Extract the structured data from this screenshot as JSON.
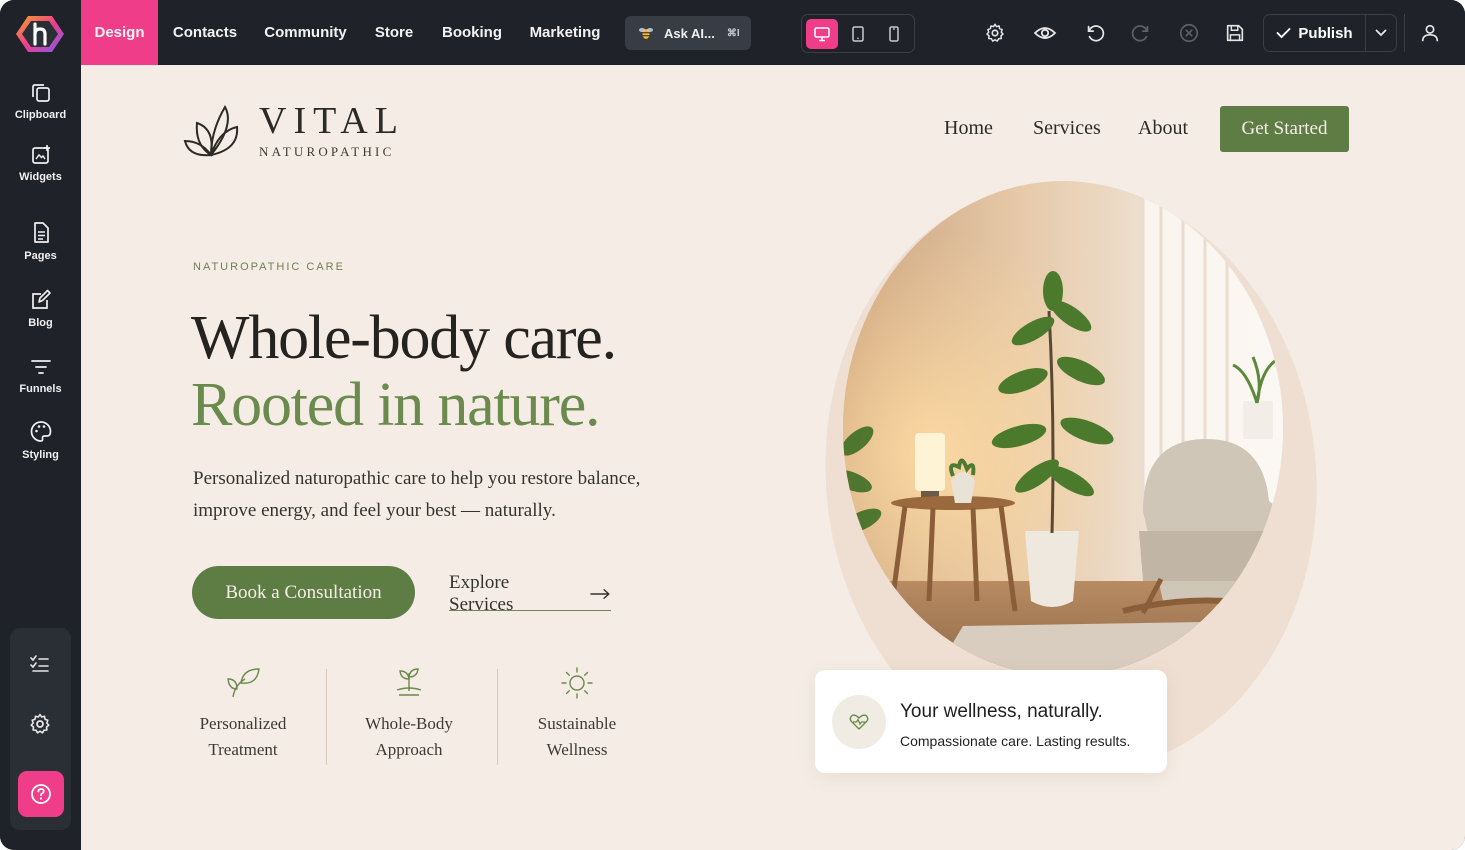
{
  "builder": {
    "nav_tabs": [
      {
        "label": "Design",
        "active": true
      },
      {
        "label": "Contacts"
      },
      {
        "label": "Community"
      },
      {
        "label": "Store"
      },
      {
        "label": "Booking"
      },
      {
        "label": "Marketing"
      }
    ],
    "ask_ai": {
      "label": "Ask AI...",
      "shortcut": "⌘I"
    },
    "device_modes": [
      "desktop-icon",
      "tablet-icon",
      "mobile-icon"
    ],
    "toolbar_icons": [
      "settings-icon",
      "preview-eye-icon",
      "undo-icon",
      "redo-icon",
      "close-circle-icon",
      "save-icon"
    ],
    "publish_label": "Publish",
    "sidebar": [
      {
        "label": "Clipboard",
        "icon": "clipboard-icon"
      },
      {
        "label": "Widgets",
        "icon": "widgets-icon"
      },
      {
        "label": "Pages",
        "icon": "pages-icon"
      },
      {
        "label": "Blog",
        "icon": "blog-icon"
      },
      {
        "label": "Funnels",
        "icon": "funnels-icon"
      },
      {
        "label": "Styling",
        "icon": "palette-icon"
      }
    ],
    "sidebar_bottom_icons": [
      "checklist-icon",
      "settings-icon",
      "help-icon"
    ],
    "colors": {
      "accent": "#ef3d8a",
      "chrome": "#1f2329"
    }
  },
  "site": {
    "brand_name": "VITAL",
    "brand_tagline": "NATUROPATHIC",
    "nav": [
      "Home",
      "Services",
      "About"
    ],
    "cta_top": "Get Started",
    "eyebrow": "NATUROPATHIC CARE",
    "headline_1": "Whole-body care.",
    "headline_2": "Rooted in nature.",
    "lead": "Personalized naturopathic care to help you restore balance, improve energy, and feel your best — naturally.",
    "primary_button": "Book a Consultation",
    "secondary_link": "Explore Services",
    "features": [
      {
        "line1": "Personalized",
        "line2": "Treatment",
        "icon": "leaf-sprout-icon"
      },
      {
        "line1": "Whole-Body",
        "line2": "Approach",
        "icon": "plant-hand-icon"
      },
      {
        "line1": "Sustainable",
        "line2": "Wellness",
        "icon": "sun-icon"
      }
    ],
    "card_title": "Your wellness, naturally.",
    "card_subtitle": "Compassionate care. Lasting results.",
    "colors": {
      "green": "#5e7d45",
      "background": "#f5ede5"
    }
  }
}
